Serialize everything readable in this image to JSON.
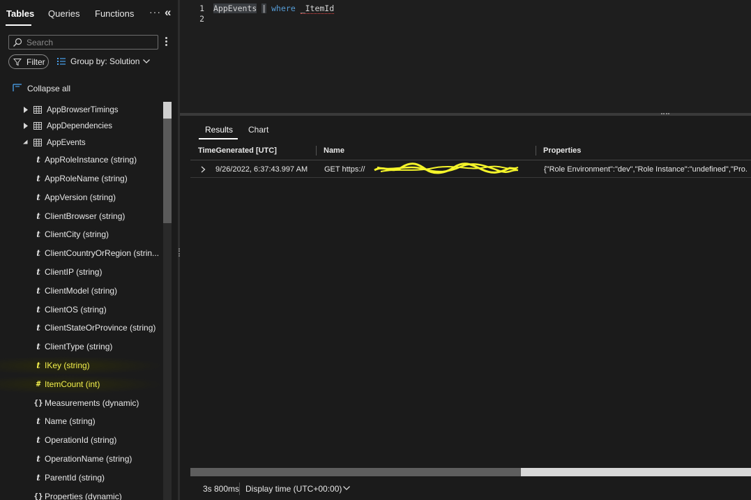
{
  "sidebar": {
    "tabs": [
      "Tables",
      "Queries",
      "Functions"
    ],
    "more_label": "···",
    "collapse_label": "«",
    "search_placeholder": "Search",
    "filter_label": "Filter",
    "groupby_label": "Group by: Solution",
    "collapse_all_label": "Collapse all",
    "tables": [
      {
        "name": "AppBrowserTimings",
        "expanded": false
      },
      {
        "name": "AppDependencies",
        "expanded": false
      },
      {
        "name": "AppEvents",
        "expanded": true
      }
    ],
    "columns": [
      {
        "icon": "t",
        "label": "AppRoleInstance (string)"
      },
      {
        "icon": "t",
        "label": "AppRoleName (string)"
      },
      {
        "icon": "t",
        "label": "AppVersion (string)"
      },
      {
        "icon": "t",
        "label": "ClientBrowser (string)"
      },
      {
        "icon": "t",
        "label": "ClientCity (string)"
      },
      {
        "icon": "t",
        "label": "ClientCountryOrRegion (strin..."
      },
      {
        "icon": "t",
        "label": "ClientIP (string)"
      },
      {
        "icon": "t",
        "label": "ClientModel (string)"
      },
      {
        "icon": "t",
        "label": "ClientOS (string)"
      },
      {
        "icon": "t",
        "label": "ClientStateOrProvince (string)"
      },
      {
        "icon": "t",
        "label": "ClientType (string)"
      },
      {
        "icon": "t",
        "label": "IKey (string)",
        "highlight": true
      },
      {
        "icon": "#",
        "label": "ItemCount (int)",
        "highlight": true
      },
      {
        "icon": "{}",
        "label": "Measurements (dynamic)"
      },
      {
        "icon": "t",
        "label": "Name (string)"
      },
      {
        "icon": "t",
        "label": "OperationId (string)"
      },
      {
        "icon": "t",
        "label": "OperationName (string)"
      },
      {
        "icon": "t",
        "label": "ParentId (string)"
      },
      {
        "icon": "{}",
        "label": "Properties (dynamic)"
      }
    ]
  },
  "editor": {
    "line_numbers": [
      "1",
      "2"
    ],
    "line1": {
      "table": "AppEvents",
      "pipe": "|",
      "keyword": "where",
      "field": "_ItemId"
    }
  },
  "results": {
    "tabs": [
      "Results",
      "Chart"
    ],
    "headers": [
      "TimeGenerated [UTC]",
      "Name",
      "Properties"
    ],
    "rows": [
      {
        "time": "9/26/2022, 6:37:43.997 AM",
        "name": "GET https://",
        "properties": "{\"Role Environment\":\"dev\",\"Role Instance\":\"undefined\",\"Pro..."
      }
    ],
    "scroll_fraction": 0.59
  },
  "status": {
    "duration": "3s 800ms",
    "display_time": "Display time (UTC+00:00)"
  },
  "colors": {
    "background": "#1b1b1b",
    "highlight_text": "#f2ee4d",
    "keyword": "#569cd6",
    "scribble": "#f5f52a"
  }
}
